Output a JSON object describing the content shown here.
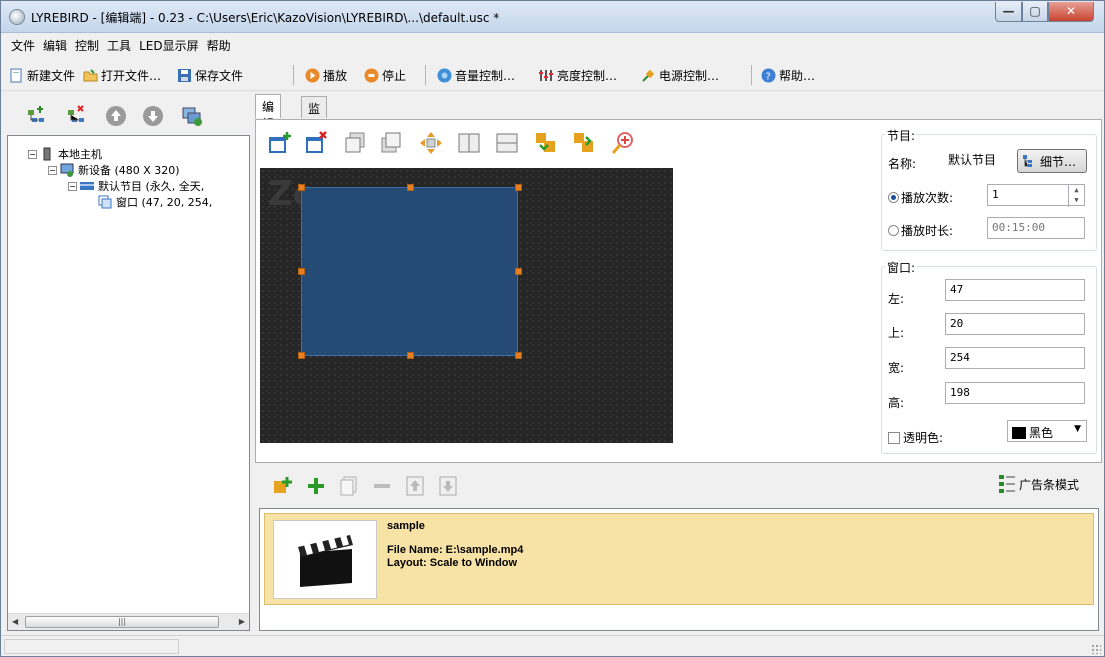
{
  "window": {
    "title": "LYREBIRD - [编辑端] - 0.23 - C:\\Users\\Eric\\KazoVision\\LYREBIRD\\...\\default.usc *",
    "min": "—",
    "max": "▢",
    "close": "✕"
  },
  "menu": [
    "文件",
    "编辑",
    "控制",
    "工具",
    "LED显示屏",
    "帮助"
  ],
  "toolbar": {
    "new_file": "新建文件",
    "open_file": "打开文件…",
    "save_file": "保存文件",
    "play": "播放",
    "stop": "停止",
    "volume": "音量控制…",
    "brightness": "亮度控制…",
    "power": "电源控制…",
    "help": "帮助…"
  },
  "tree": {
    "root": "本地主机",
    "device": "新设备  (480 X 320)",
    "program": "默认节目  (永久, 全天,",
    "window": "窗口  (47, 20, 254,"
  },
  "tabs": [
    "编辑",
    "监控"
  ],
  "canvas": {
    "watermark": "Ze"
  },
  "program_group": {
    "title": "节目:",
    "name_label": "名称:",
    "name_value": "默认节目",
    "detail_button": "细节…",
    "play_count_label": "播放次数:",
    "play_count_value": "1",
    "play_duration_label": "播放时长:",
    "play_duration_value": "00:15:00"
  },
  "window_group": {
    "title": "窗口:",
    "left_label": "左:",
    "left_value": "47",
    "top_label": "上:",
    "top_value": "20",
    "width_label": "宽:",
    "width_value": "254",
    "height_label": "高:",
    "height_value": "198",
    "transparent_label": "透明色:",
    "color_value": "黑色"
  },
  "playlist": {
    "mode_button": "广告条模式",
    "items": [
      {
        "name": "sample",
        "file_line": "File Name: E:\\sample.mp4",
        "layout_line": "Layout: Scale to Window"
      }
    ]
  },
  "colors": {
    "accent": "#254a73",
    "handle": "#e67e22",
    "item_bg": "#f7e3a5"
  }
}
